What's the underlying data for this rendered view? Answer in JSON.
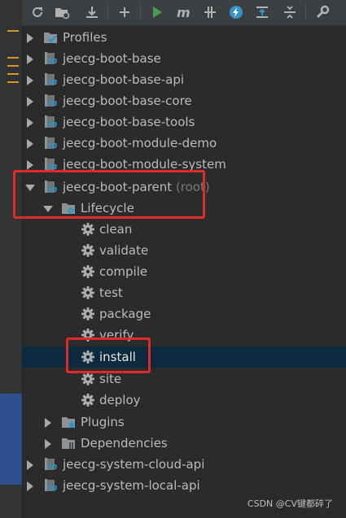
{
  "toolbar": {
    "buttons": [
      "refresh-icon",
      "reimport-folder-icon",
      "download-icon",
      "add-icon",
      "run-icon",
      "maven-goal-icon",
      "toggle-offline-icon",
      "lightning-icon",
      "show-dependencies-icon",
      "collapse-all-icon",
      "settings-wrench-icon"
    ]
  },
  "tree": {
    "profiles": "Profiles",
    "modules": [
      "jeecg-boot-base",
      "jeecg-boot-base-api",
      "jeecg-boot-base-core",
      "jeecg-boot-base-tools",
      "jeecg-boot-module-demo",
      "jeecg-boot-module-system"
    ],
    "parent": {
      "name": "jeecg-boot-parent",
      "suffix": "(root)"
    },
    "lifecycle": "Lifecycle",
    "goals": [
      "clean",
      "validate",
      "compile",
      "test",
      "package",
      "verify",
      "install",
      "site",
      "deploy"
    ],
    "selected_goal": "install",
    "plugins": "Plugins",
    "dependencies": "Dependencies",
    "tail_modules": [
      "jeecg-system-cloud-api",
      "jeecg-system-local-api"
    ]
  },
  "watermark": "CSDN @CV键都碎了",
  "colors": {
    "background": "#2b2b2b",
    "selection": "#0d293e",
    "annotation": "#e02a2a",
    "text": "#bbbbbb",
    "muted": "#787878"
  }
}
